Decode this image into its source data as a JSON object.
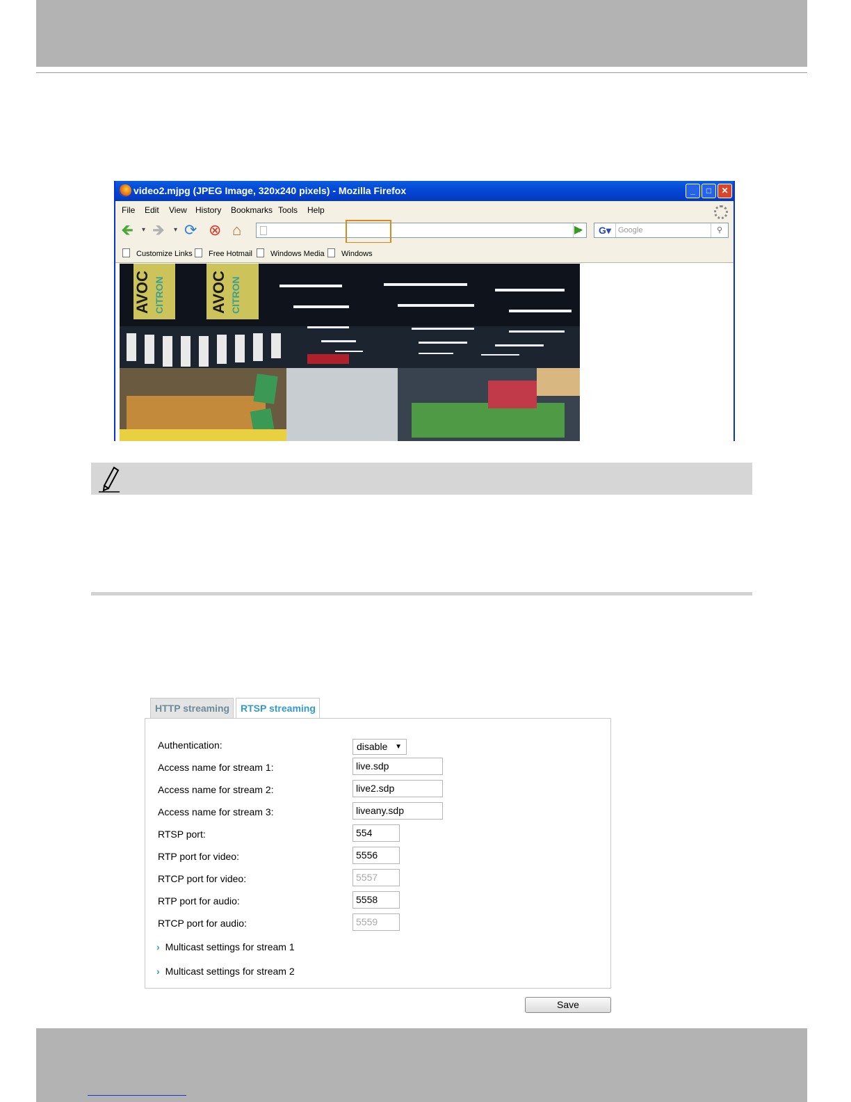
{
  "browser": {
    "title": "video2.mjpg (JPEG Image, 320x240 pixels) - Mozilla Firefox",
    "menu": [
      "File",
      "Edit",
      "View",
      "History",
      "Bookmarks",
      "Tools",
      "Help"
    ],
    "search_placeholder": "Google",
    "bookmarks": [
      "Customize Links",
      "Free Hotmail",
      "Windows Media",
      "Windows"
    ],
    "window_buttons": [
      "minimize-icon",
      "maximize-icon",
      "close-icon"
    ],
    "image_text": [
      "AVOC",
      "CITRON",
      "AVOC",
      "CITRON"
    ]
  },
  "rtsp": {
    "tabs": [
      "HTTP streaming",
      "RTSP streaming"
    ],
    "fields": [
      {
        "label": "Authentication:",
        "value": "disable",
        "type": "select"
      },
      {
        "label": "Access name for stream 1:",
        "value": "live.sdp",
        "type": "text"
      },
      {
        "label": "Access name for stream 2:",
        "value": "live2.sdp",
        "type": "text"
      },
      {
        "label": "Access name for stream 3:",
        "value": "liveany.sdp",
        "type": "text"
      },
      {
        "label": "RTSP port:",
        "value": "554",
        "type": "text"
      },
      {
        "label": "RTP port for video:",
        "value": "5556",
        "type": "text"
      },
      {
        "label": "RTCP port for video:",
        "value": "5557",
        "type": "disabled"
      },
      {
        "label": "RTP port for audio:",
        "value": "5558",
        "type": "text"
      },
      {
        "label": "RTCP port for audio:",
        "value": "5559",
        "type": "disabled"
      }
    ],
    "multicast": [
      "Multicast settings for stream 1",
      "Multicast settings for stream 2"
    ],
    "save_label": "Save"
  },
  "colors": {
    "header_gray": "#b3b3b3",
    "tab_active": "#3399cc",
    "highlight_box": "#d88a20",
    "xp_title_blue": "#0549d6"
  }
}
